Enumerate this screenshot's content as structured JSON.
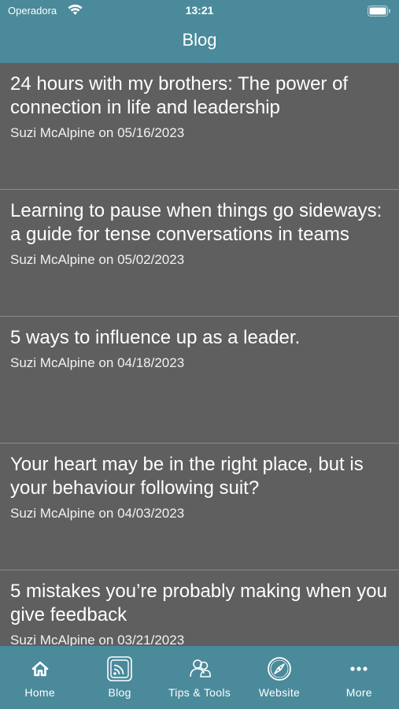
{
  "status_bar": {
    "carrier": "Operadora",
    "time": "13:21"
  },
  "header": {
    "title": "Blog"
  },
  "posts": [
    {
      "title": "24 hours with my brothers: The power of connection in life and leadership",
      "meta": "Suzi McAlpine on 05/16/2023"
    },
    {
      "title": "Learning to pause when things go sideways: a guide for tense conversations in teams",
      "meta": "Suzi McAlpine on 05/02/2023"
    },
    {
      "title": "5 ways to influence up as a leader.",
      "meta": "Suzi McAlpine on 04/18/2023"
    },
    {
      "title": "Your heart may be in the right place, but is your behaviour following suit?",
      "meta": "Suzi McAlpine on 04/03/2023"
    },
    {
      "title": "5 mistakes you’re probably making when you give feedback",
      "meta": "Suzi McAlpine on 03/21/2023"
    }
  ],
  "tabbar": {
    "items": [
      {
        "label": "Home",
        "icon": "home-icon"
      },
      {
        "label": "Blog",
        "icon": "rss-icon",
        "active": true
      },
      {
        "label": "Tips & Tools",
        "icon": "people-icon"
      },
      {
        "label": "Website",
        "icon": "compass-icon"
      },
      {
        "label": "More",
        "icon": "more-icon"
      }
    ]
  },
  "colors": {
    "accent": "#4a8a9b",
    "background": "#5f5f5f",
    "divider": "#8a8a8a",
    "text": "#ffffff"
  }
}
